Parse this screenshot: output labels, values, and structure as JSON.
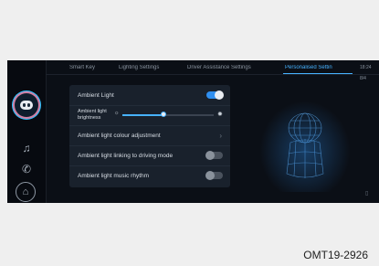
{
  "tabs": [
    {
      "label": "Smart Key",
      "active": false
    },
    {
      "label": "Lighting Settings",
      "active": false
    },
    {
      "label": "Driver Assistance Settings",
      "active": false
    },
    {
      "label": "Personalised Settin",
      "active": true
    }
  ],
  "status": {
    "time": "18:24",
    "indicator": "8/4"
  },
  "settings": {
    "ambient_light": {
      "label": "Ambient Light",
      "enabled": true
    },
    "brightness": {
      "label_line1": "Ambient light",
      "label_line2": "brightness",
      "level": 0.45
    },
    "colour": {
      "label": "Ambient light colour adjustment"
    },
    "driving_mode": {
      "label": "Ambient light linking to driving mode",
      "enabled": false
    },
    "music_rhythm": {
      "label": "Ambient light music rhythm",
      "enabled": false
    }
  },
  "rail_icons": [
    "assistant-avatar",
    "music-icon",
    "phone-icon",
    "home-icon"
  ],
  "colors": {
    "accent": "#47b2ff",
    "toggle_on": "#2f8ff0",
    "panel": "#19212c"
  },
  "caption": "OMT19-2926"
}
